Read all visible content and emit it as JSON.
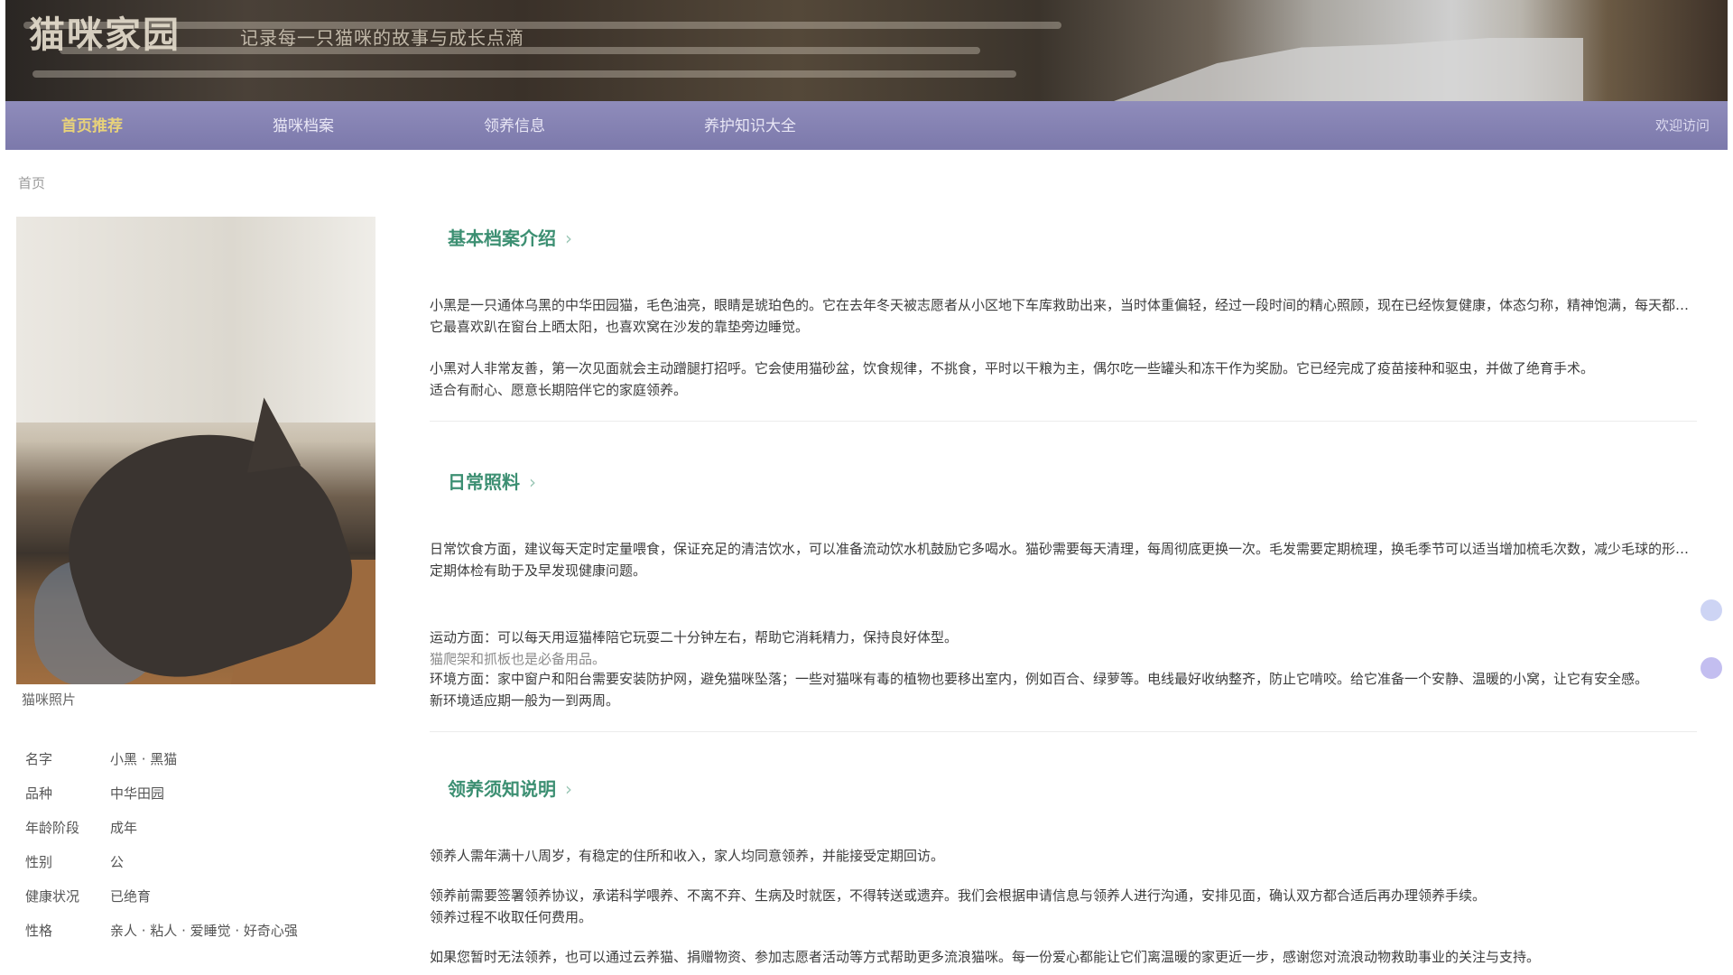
{
  "banner": {
    "site_title": "猫咪家园",
    "site_subtitle": "记录每一只猫咪的故事与成长点滴"
  },
  "nav": {
    "items": [
      {
        "label": "首页推荐",
        "active": true
      },
      {
        "label": "猫咪档案",
        "active": false
      },
      {
        "label": "领养信息",
        "active": false
      },
      {
        "label": "养护知识大全",
        "active": false
      }
    ],
    "right_text": "欢迎访问"
  },
  "breadcrumb": "首页",
  "profile": {
    "caption": "猫咪照片",
    "fields": [
      {
        "key": "名字",
        "value": "小黑 · 黑猫"
      },
      {
        "key": "品种",
        "value": "中华田园"
      },
      {
        "key": "年龄阶段",
        "value": "成年"
      },
      {
        "key": "性别",
        "value": "公"
      },
      {
        "key": "健康状况",
        "value": "已绝育"
      },
      {
        "key": "性格",
        "value": "亲人 · 粘人 · 爱睡觉 · 好奇心强"
      }
    ]
  },
  "sections": [
    {
      "title": "基本档案介绍",
      "paragraphs": [
        [
          "小黑是一只通体乌黑的中华田园猫，毛色油亮，眼睛是琥珀色的。它在去年冬天被志愿者从小区地下车库救助出来，当时体重偏轻，经过一段时间的精心照顾，现在已经恢复健康，体态匀称，精神饱满，每天都很有活力。",
          "它最喜欢趴在窗台上晒太阳，也喜欢窝在沙发的靠垫旁边睡觉。"
        ],
        [
          "小黑对人非常友善，第一次见面就会主动蹭腿打招呼。它会使用猫砂盆，饮食规律，不挑食，平时以干粮为主，偶尔吃一些罐头和冻干作为奖励。它已经完成了疫苗接种和驱虫，并做了绝育手术。",
          "适合有耐心、愿意长期陪伴它的家庭领养。"
        ]
      ]
    },
    {
      "title": "日常照料",
      "paragraphs": [
        [
          "日常饮食方面，建议每天定时定量喂食，保证充足的清洁饮水，可以准备流动饮水机鼓励它多喝水。猫砂需要每天清理，每周彻底更换一次。毛发需要定期梳理，换毛季节可以适当增加梳毛次数，减少毛球的形成，同时注意观察它的排便和精神状态，如有异常及时就医。",
          "定期体检有助于及早发现健康问题。"
        ],
        [
          "运动方面：可以每天用逗猫棒陪它玩耍二十分钟左右，帮助它消耗精力，保持良好体型。",
          "猫爬架和抓板也是必备用品。"
        ],
        [
          "环境方面：家中窗户和阳台需要安装防护网，避免猫咪坠落；一些对猫咪有毒的植物也要移出室内，例如百合、绿萝等。电线最好收纳整齐，防止它啃咬。给它准备一个安静、温暖的小窝，让它有安全感。",
          "新环境适应期一般为一到两周。"
        ]
      ]
    },
    {
      "title": "领养须知说明",
      "paragraphs": [
        [
          "领养人需年满十八周岁，有稳定的住所和收入，家人均同意领养，并能接受定期回访。"
        ],
        [
          "领养前需要签署领养协议，承诺科学喂养、不离不弃、生病及时就医，不得转送或遗弃。我们会根据申请信息与领养人进行沟通，安排见面，确认双方都合适后再办理领养手续。",
          "领养过程不收取任何费用。"
        ],
        [
          "如果您暂时无法领养，也可以通过云养猫、捐赠物资、参加志愿者活动等方式帮助更多流浪猫咪。每一份爱心都能让它们离温暖的家更近一步，感谢您对流浪动物救助事业的关注与支持。"
        ]
      ]
    }
  ]
}
